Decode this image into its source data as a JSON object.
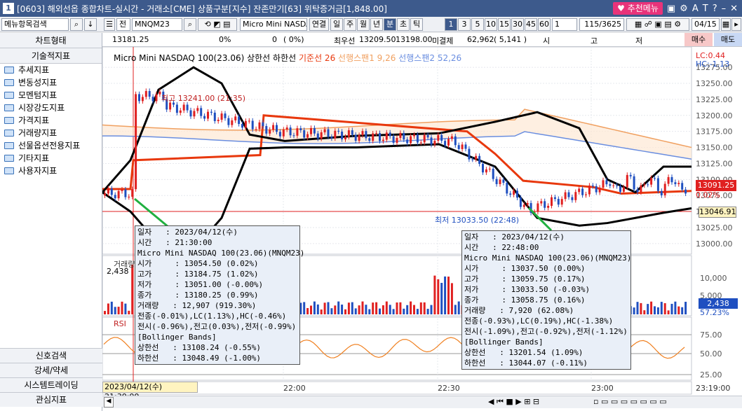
{
  "window": {
    "num": "1",
    "title": "[0603] 해외선옵 종합차트-실시간 - 거래소[CME] 상품구분[지수] 잔존만기[63] 위탁증거금[1,848.00]",
    "recommend_menu": "추천메뉴",
    "icons": [
      "gear-icon",
      "screen-icon",
      "font-size-icon",
      "text-icon",
      "help-icon",
      "minimize-icon",
      "close-icon"
    ]
  },
  "toolbar": {
    "menu_search": "메뉴항목검색",
    "all_label": "전",
    "symbol": "MNQM23",
    "product_name": "Micro Mini NASDAQ 100",
    "link_label": "연결",
    "periods": [
      "일",
      "주",
      "월",
      "년",
      "분",
      "초",
      "틱"
    ],
    "active_period": "분",
    "intervals": [
      "1",
      "3",
      "5",
      "10",
      "15",
      "30",
      "45",
      "60"
    ],
    "active_interval": "1",
    "count": "1",
    "range": "115/3625",
    "date": "04/15"
  },
  "pricebar": {
    "price": "13181.25",
    "pct1": "0%",
    "val2": "0",
    "paren": "(   0%)",
    "best_ask_label": "최우선",
    "best_ask": "13209.50",
    "best_bid": "13198.00",
    "open_interest_label": "미결제",
    "open_interest": "62,962",
    "oi_change": "( 5,141 )",
    "high_label": "시",
    "mid_label": "고",
    "low_label": "저",
    "buy": "매수",
    "sell": "매도"
  },
  "sidebar": {
    "top": "차트형태",
    "section": "기술적지표",
    "items": [
      "추세지표",
      "변동성지표",
      "모멘텀지표",
      "시장강도지표",
      "가격지표",
      "거래량지표",
      "선물옵션전용지표",
      "기타지표",
      "사용자지표"
    ],
    "bottom": [
      "신호검색",
      "강세/약세",
      "시스템트레이딩",
      "관심지표"
    ]
  },
  "chart": {
    "legend": {
      "name": "Micro Mini NASDAQ 100(23.06)",
      "upper": "상한선",
      "lower": "하한선",
      "base": "기준선 26",
      "span1": "선행스팬1 9,26",
      "span2": "선행스팬2 52,26"
    },
    "lc": "LC:0.44",
    "hc": "HC:-1.13",
    "current_price": "13091.25",
    "current_pct": "0.02%",
    "marker_price": "13046.91",
    "volume_current": "2,438",
    "volume_pct": "57.23%",
    "volume_axis_label": "거래량",
    "volume_first": "2,438",
    "rsi_label": "RSI",
    "high_annotation": "최고 13241.00 (21:35)",
    "low_annotation": "최저 13033.50 (22:48)",
    "price_ticks": [
      "13275.00",
      "13250.00",
      "13225.00",
      "13200.00",
      "13175.00",
      "13150.00",
      "13125.00",
      "13100.00",
      "13075.00",
      "13050.00",
      "13025.00",
      "13000.00"
    ],
    "vol_ticks": [
      "10,000",
      "5,000"
    ],
    "rsi_ticks": [
      "75.00",
      "50.00",
      "25.00"
    ],
    "time_ticks": [
      "22:00",
      "22:30",
      "23:00",
      "23:19:00"
    ],
    "cursor_time": "2023/04/12(수) 21:30:00",
    "tooltip1": [
      "일자   : 2023/04/12(수)",
      "시간   : 21:30:00",
      "Micro Mini NASDAQ 100(23.06)(MNQM23)",
      "시가     : 13054.50 (0.02%)",
      "고가     : 13184.75 (1.02%)",
      "저가     : 13051.00 (-0.00%)",
      "종가     : 13180.25 (0.99%)",
      "거래량   : 12,907 (919.30%)",
      "전종(-0.01%),LC(1.13%),HC(-0.46%)",
      "전시(-0.96%),전고(0.03%),전저(-0.99%)",
      "[Bollinger Bands]",
      "상한선   : 13108.24 (-0.55%)",
      "하한선   : 13048.49 (-1.00%)"
    ],
    "tooltip2": [
      "일자   : 2023/04/12(수)",
      "시간   : 22:48:00",
      "Micro Mini NASDAQ 100(23.06)(MNQM23)",
      "시가     : 13037.50 (0.00%)",
      "고가     : 13059.75 (0.17%)",
      "저가     : 13033.50 (-0.03%)",
      "종가     : 13058.75 (0.16%)",
      "거래량   : 7,920 (62.08%)",
      "전종(-0.93%),LC(0.19%),HC(-1.38%)",
      "전시(-1.09%),전고(-0.92%),전저(-1.12%)",
      "[Bollinger Bands]",
      "상한선   : 13201.54 (1.09%)",
      "하한선   : 13044.07 (-0.11%)"
    ]
  },
  "colors": {
    "title": "#3d5a8c",
    "up": "#e02020",
    "down": "#1f4fc0",
    "upper_band": "#000000",
    "base_line": "#e8380d",
    "span1": "#f0a060",
    "span2": "#6a8ee0",
    "price_badge": "#e02020",
    "volume_badge": "#1f4fc0"
  }
}
